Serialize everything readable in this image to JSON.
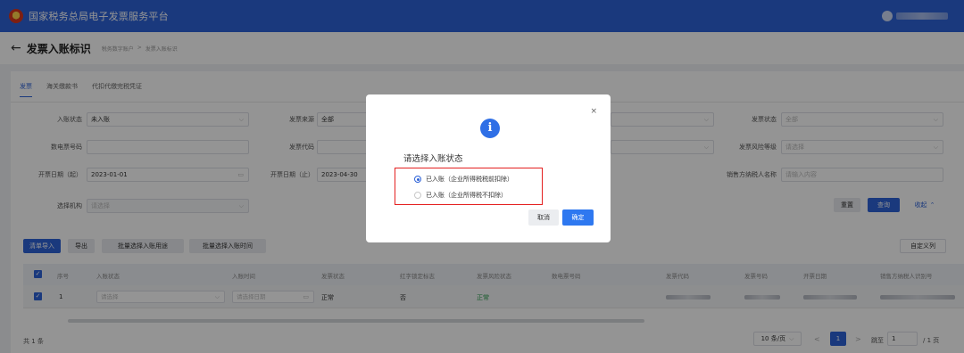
{
  "app": {
    "title": "国家税务总局电子发票服务平台"
  },
  "page": {
    "back_icon": "arrow-left-icon",
    "title": "发票入账标识",
    "breadcrumb": [
      "税务数字账户",
      ">",
      "发票入账标识"
    ]
  },
  "tabs": [
    {
      "label": "发票",
      "active": true
    },
    {
      "label": "海关缴款书",
      "active": false
    },
    {
      "label": "代扣代缴完税凭证",
      "active": false
    }
  ],
  "filters": {
    "entry_status": {
      "label": "入账状态",
      "value": "未入账"
    },
    "invoice_source": {
      "label": "发票来源",
      "value": "全部"
    },
    "invoice_status": {
      "label": "发票状态",
      "placeholder": "全部"
    },
    "digital_invoice_no": {
      "label": "数电票号码",
      "value": ""
    },
    "invoice_code": {
      "label": "发票代码",
      "value": ""
    },
    "risk_level": {
      "label": "发票风险等级",
      "placeholder": "请选择"
    },
    "date_start": {
      "label": "开票日期（起）",
      "value": "2023-01-01"
    },
    "date_end": {
      "label": "开票日期（止）",
      "value": "2023-04-30"
    },
    "seller_name": {
      "label": "销售方纳税人名称",
      "placeholder": "请输入内容"
    },
    "org": {
      "label": "选择机构",
      "placeholder": "请选择"
    }
  },
  "filter_buttons": {
    "reset": "重置",
    "query": "查询",
    "collapse": "收起"
  },
  "toolbar": {
    "list_import": "清单导入",
    "export": "导出",
    "batch_purpose": "批量选择入账用途",
    "batch_time": "批量选择入账时间",
    "custom_columns": "自定义列"
  },
  "table": {
    "headers": [
      "序号",
      "入账状态",
      "入账时间",
      "发票状态",
      "红字锁定标志",
      "发票风险状态",
      "数电票号码",
      "发票代码",
      "发票号码",
      "开票日期",
      "销售方纳税人识别号"
    ],
    "rows": [
      {
        "index": "1",
        "entry_status_placeholder": "请选择",
        "entry_time_placeholder": "请选择日期",
        "invoice_status": "正常",
        "red_lock": "否",
        "risk_status": "正常"
      }
    ]
  },
  "footer": {
    "total": "共 1 条",
    "page_size": "10 条/页",
    "prev": "<",
    "page": "1",
    "next": ">",
    "goto_label": "跳至",
    "goto_value": "1",
    "total_pages": "/ 1 页"
  },
  "modal": {
    "icon": "info-icon",
    "close": "×",
    "title": "请选择入账状态",
    "options": [
      {
        "label": "已入账（企业所得税税前扣除）",
        "checked": true
      },
      {
        "label": "已入账（企业所得税不扣除）",
        "checked": false
      }
    ],
    "cancel": "取消",
    "confirm": "确定",
    "highlight_color": "#e42020"
  },
  "colors": {
    "primary": "#2e63d8",
    "topbar": "#2e63d8",
    "modal_confirm": "#2e78f0"
  }
}
